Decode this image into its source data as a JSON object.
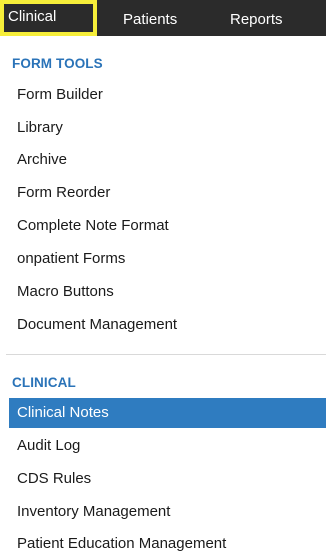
{
  "topnav": {
    "tabs": [
      {
        "label": "Clinical",
        "active": true
      },
      {
        "label": "Patients",
        "active": false
      },
      {
        "label": "Reports",
        "active": false
      }
    ],
    "highlight_color": "#f6ee3a"
  },
  "sections": [
    {
      "title": "FORM TOOLS",
      "items": [
        "Form Builder",
        "Library",
        "Archive",
        "Form Reorder",
        "Complete Note Format",
        "onpatient Forms",
        "Macro Buttons",
        "Document Management"
      ]
    },
    {
      "title": "CLINICAL",
      "items": [
        "Clinical Notes",
        "Audit Log",
        "CDS Rules",
        "Inventory Management",
        "Patient Education Management"
      ],
      "active_item": "Clinical Notes"
    }
  ],
  "colors": {
    "section_title": "#2a73b8",
    "active_bg": "#2f7cc0",
    "nav_bg": "#2b2b2b"
  }
}
